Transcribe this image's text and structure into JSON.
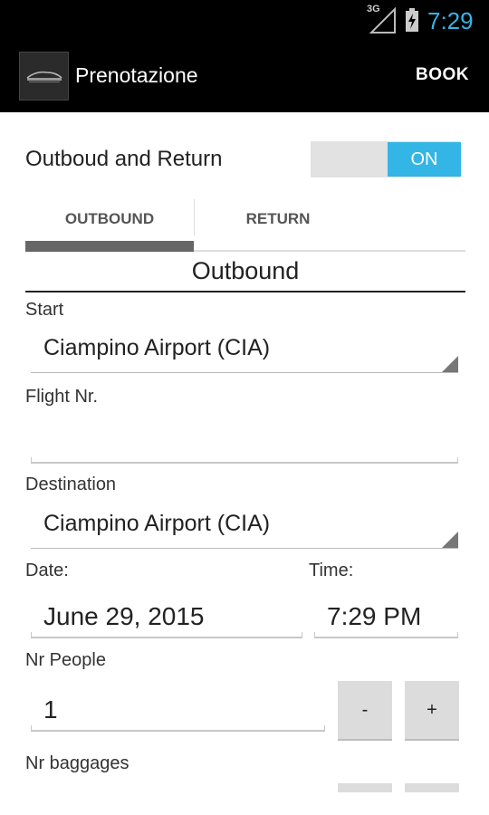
{
  "status_bar": {
    "network": "3G",
    "time": "7:29",
    "time_color": "#33b5e5"
  },
  "action_bar": {
    "title": "Prenotazione",
    "book_label": "BOOK"
  },
  "switch": {
    "label": "Outboud and Return",
    "state": "ON",
    "accent": "#33b5e5"
  },
  "tabs": [
    {
      "label": "OUTBOUND",
      "selected": true
    },
    {
      "label": "RETURN",
      "selected": false
    }
  ],
  "section": {
    "title": "Outbound"
  },
  "form": {
    "start": {
      "label": "Start",
      "value": "Ciampino Airport (CIA)"
    },
    "flight": {
      "label": "Flight Nr.",
      "value": ""
    },
    "destination": {
      "label": "Destination",
      "value": "Ciampino Airport (CIA)"
    },
    "date": {
      "label": "Date:",
      "value": "June 29, 2015"
    },
    "time": {
      "label": "Time:",
      "value": "7:29 PM"
    },
    "people": {
      "label": "Nr People",
      "value": "1",
      "minus": "-",
      "plus": "+"
    },
    "baggages": {
      "label": "Nr baggages"
    }
  }
}
